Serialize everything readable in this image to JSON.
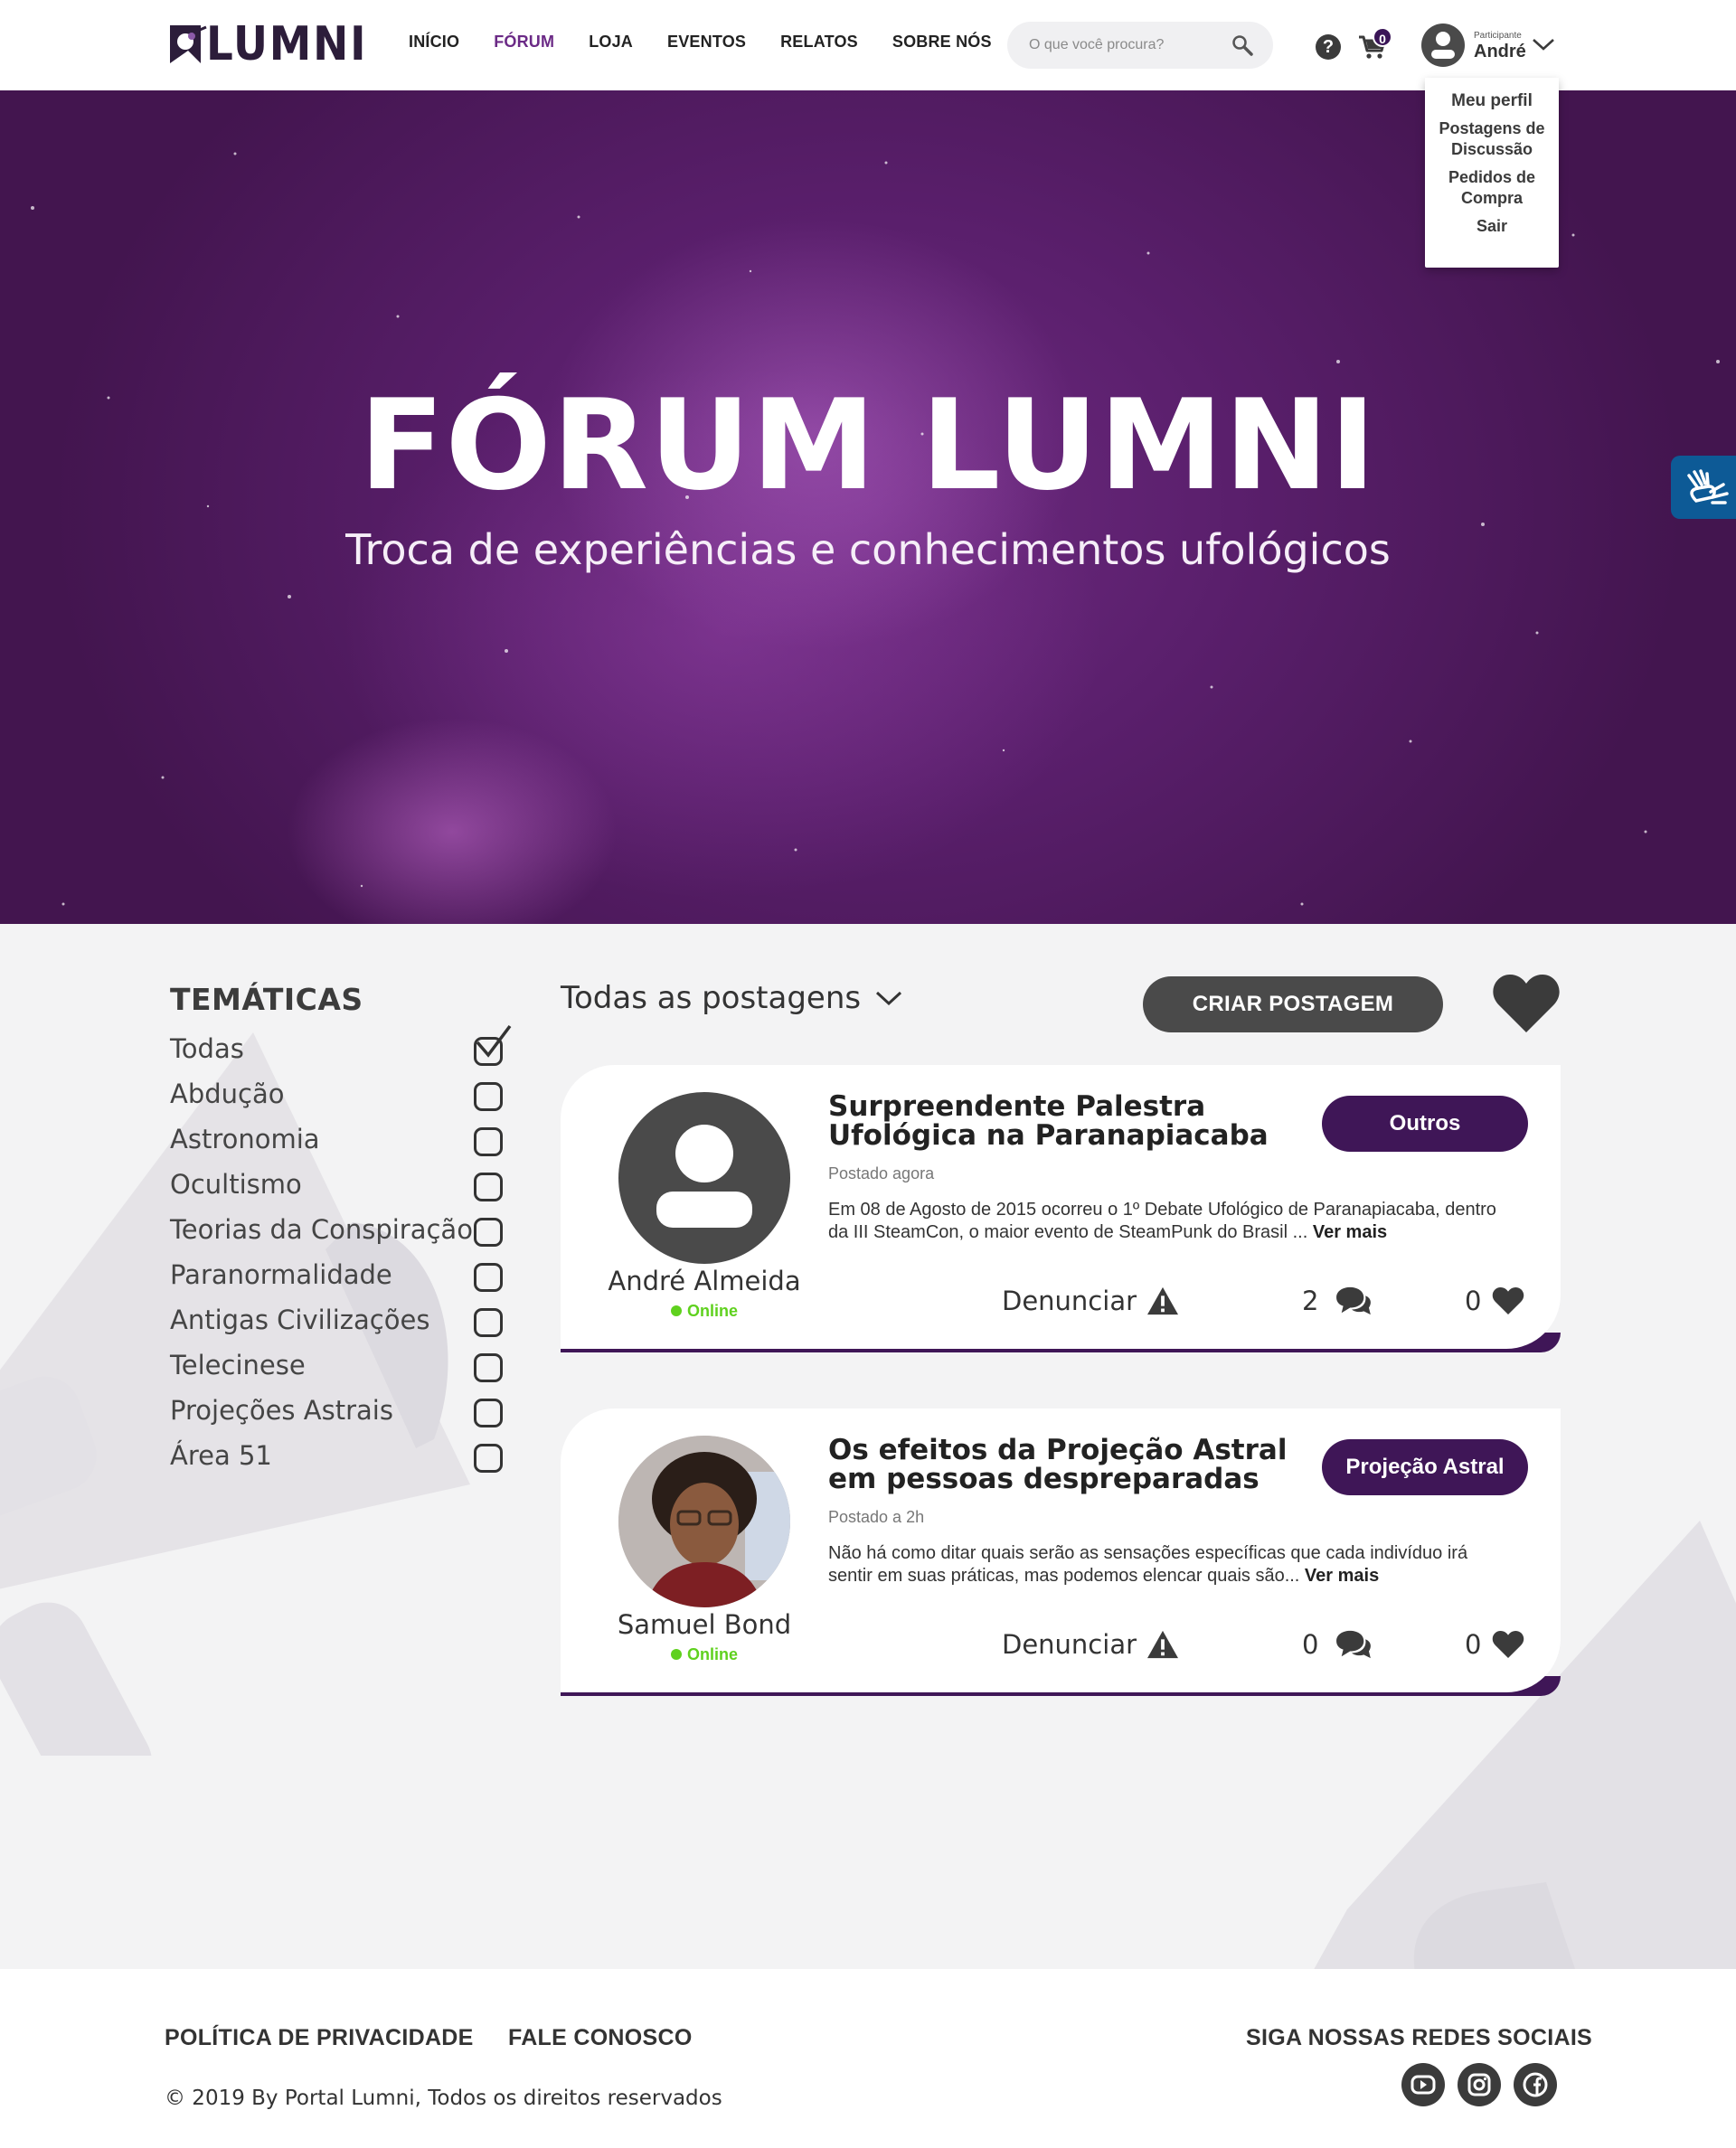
{
  "header": {
    "logo_text": "LUMNI",
    "nav": [
      {
        "label": "INÍCIO",
        "active": false
      },
      {
        "label": "FÓRUM",
        "active": true
      },
      {
        "label": "LOJA",
        "active": false
      },
      {
        "label": "EVENTOS",
        "active": false
      },
      {
        "label": "RELATOS",
        "active": false
      },
      {
        "label": "SOBRE NÓS",
        "active": false
      }
    ],
    "search_placeholder": "O que você procura?",
    "help_icon": "?",
    "cart_count": "0",
    "user": {
      "role": "Participante",
      "name": "André"
    }
  },
  "user_menu": [
    "Meu perfil",
    "Postagens de Discussão",
    "Pedidos de Compra",
    "Sair"
  ],
  "hero": {
    "title": "FÓRUM LUMNI",
    "subtitle": "Troca de experiências e conhecimentos ufológicos"
  },
  "sidebar": {
    "heading": "TEMÁTICAS",
    "topics": [
      {
        "label": "Todas",
        "checked": true
      },
      {
        "label": "Abdução",
        "checked": false
      },
      {
        "label": "Astronomia",
        "checked": false
      },
      {
        "label": "Ocultismo",
        "checked": false
      },
      {
        "label": "Teorias da Conspiração",
        "checked": false
      },
      {
        "label": "Paranormalidade",
        "checked": false
      },
      {
        "label": "Antigas Civilizações",
        "checked": false
      },
      {
        "label": "Telecinese",
        "checked": false
      },
      {
        "label": "Projeções Astrais",
        "checked": false
      },
      {
        "label": "Área 51",
        "checked": false
      }
    ]
  },
  "feed": {
    "filter_label": "Todas as postagens",
    "create_label": "CRIAR POSTAGEM",
    "posts": [
      {
        "title": "Surpreendente Palestra Ufológica na Paranapiacaba",
        "tag": "Outros",
        "time": "Postado agora",
        "excerpt": "Em 08 de Agosto de 2015 ocorreu o 1º Debate Ufológico de Paranapiacaba, dentro da III SteamCon, o maior evento de SteamPunk do Brasil ...",
        "more": "Ver mais",
        "author": "André Almeida",
        "status": "Online",
        "report": "Denunciar",
        "comments": "2",
        "likes": "0"
      },
      {
        "title": "Os efeitos da Projeção Astral em pessoas despreparadas",
        "tag": "Projeção Astral",
        "time": "Postado a 2h",
        "excerpt": "Não há como ditar quais serão as sensações específicas que cada indivíduo irá sentir em suas práticas, mas podemos elencar quais são...",
        "more": "Ver mais",
        "author": "Samuel Bond",
        "status": "Online",
        "report": "Denunciar",
        "comments": "0",
        "likes": "0"
      }
    ]
  },
  "footer": {
    "privacy": "POLÍTICA DE PRIVACIDADE",
    "contact": "FALE CONOSCO",
    "social_heading": "SIGA NOSSAS REDES SOCIAIS",
    "copyright": "© 2019 By Portal Lumni, Todos os direitos reservados",
    "social": [
      "youtube-icon",
      "instagram-icon",
      "facebook-icon"
    ]
  },
  "colors": {
    "brand": "#3f1657",
    "nav_active": "#6b2a86",
    "online": "#5fd11e",
    "accessibility": "#0d5a96"
  }
}
